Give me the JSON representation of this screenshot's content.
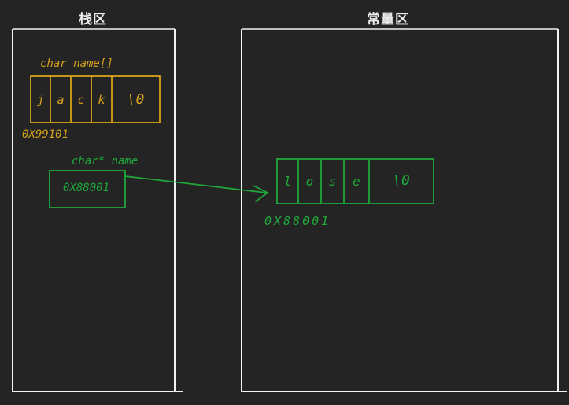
{
  "regions": {
    "stack_title": "栈区",
    "constant_title": "常量区"
  },
  "stack": {
    "array_label": "char name[]",
    "array_cells": [
      "j",
      "a",
      "c",
      "k",
      "\\0"
    ],
    "array_address": "0X99101",
    "pointer_label": "char* name",
    "pointer_value": "0X88001"
  },
  "constant": {
    "string_cells": [
      "l",
      "o",
      "s",
      "e",
      "\\0"
    ],
    "string_address": "0X88001"
  },
  "colors": {
    "background": "#242424",
    "border": "#f2f2f2",
    "array": "#d7a21a",
    "pointer": "#1fa83a"
  }
}
